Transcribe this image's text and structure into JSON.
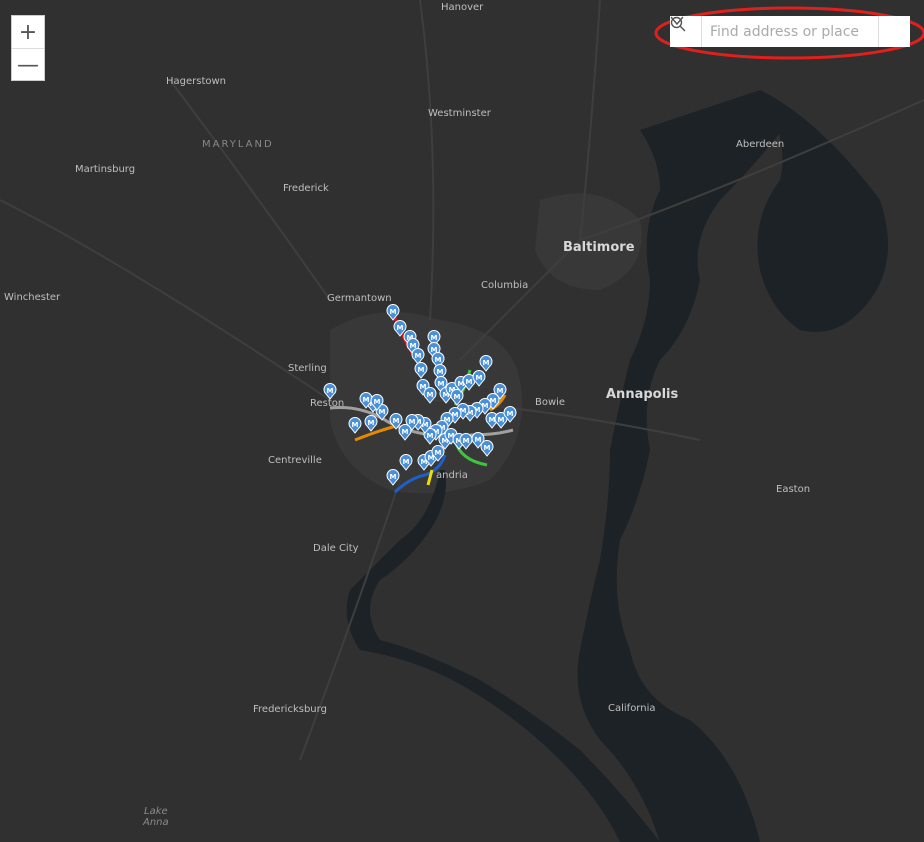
{
  "search": {
    "placeholder": "Find address or place"
  },
  "zoom": {
    "in_label": "+",
    "out_label": "—"
  },
  "places": {
    "hanover": "Hanover",
    "hagerstown": "Hagerstown",
    "westminster": "Westminster",
    "maryland": "MARYLAND",
    "aberdeen": "Aberdeen",
    "martinsburg": "Martinsburg",
    "frederick": "Frederick",
    "baltimore": "Baltimore",
    "germantown": "Germantown",
    "columbia": "Columbia",
    "winchester": "Winchester",
    "sterling": "Sterling",
    "reston": "Reston",
    "bowie": "Bowie",
    "annapolis": "Annapolis",
    "centreville": "Centreville",
    "alexandria": "andria",
    "easton": "Easton",
    "dale_city": "Dale City",
    "fredericksburg": "Fredericksburg",
    "california": "California",
    "lake_anna": "Lake\nAnna"
  },
  "metro_marker_letter": "M",
  "colors": {
    "map_bg": "#303030",
    "water": "#1c2226",
    "urban": "#3a3a3a",
    "marker": "#4a90d9",
    "red_line": "#e01010",
    "green_line": "#3ec43e",
    "orange_line": "#e58a00",
    "blue_line": "#1f5fc8",
    "silver_line": "#a0a0a0",
    "yellow_line": "#f0e000",
    "highlight": "#e0201c"
  }
}
